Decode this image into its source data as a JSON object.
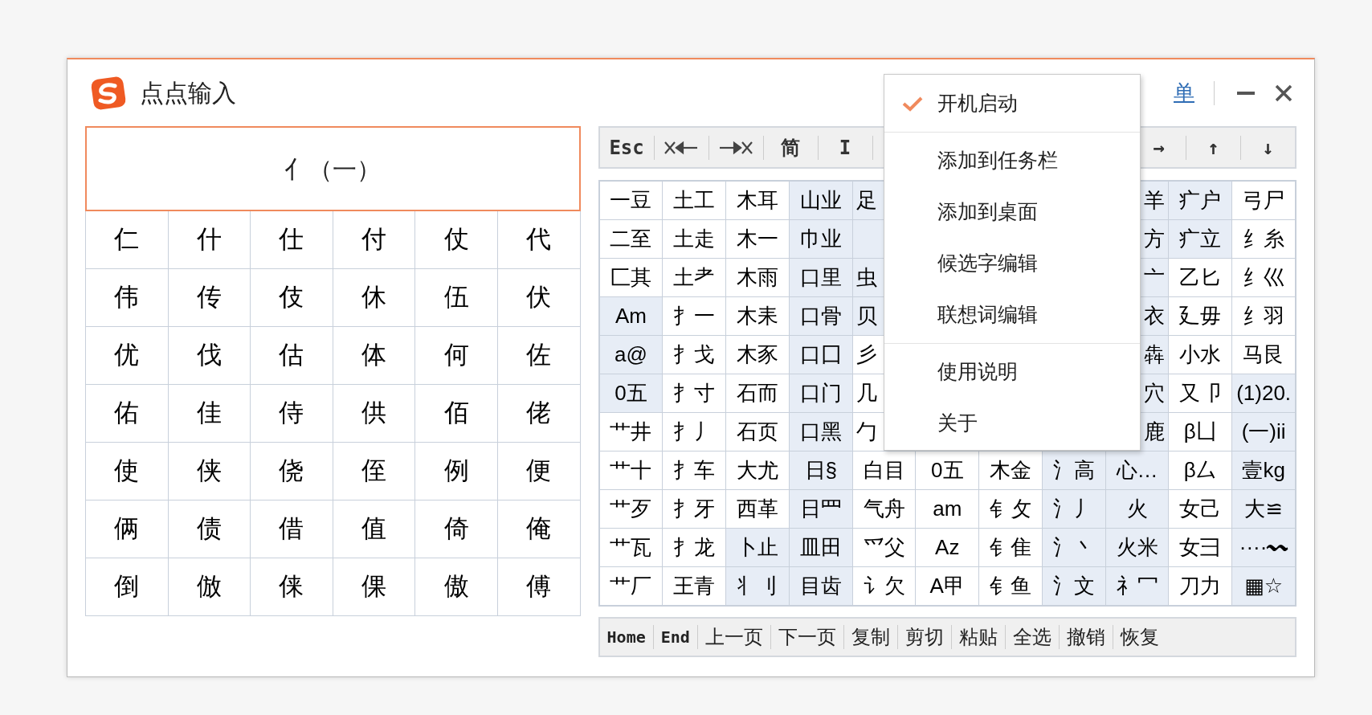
{
  "window": {
    "title": "点点输入",
    "menu_link": "单"
  },
  "candidate_header": "亻（一）",
  "candidates": [
    [
      "仁",
      "什",
      "仕",
      "付",
      "仗",
      "代"
    ],
    [
      "伟",
      "传",
      "伎",
      "休",
      "伍",
      "伏"
    ],
    [
      "优",
      "伐",
      "估",
      "体",
      "何",
      "佐"
    ],
    [
      "佑",
      "佳",
      "侍",
      "供",
      "佰",
      "佬"
    ],
    [
      "使",
      "侠",
      "侥",
      "侄",
      "例",
      "便"
    ],
    [
      "俩",
      "债",
      "借",
      "值",
      "倚",
      "俺"
    ],
    [
      "倒",
      "倣",
      "俫",
      "倮",
      "傲",
      "傅"
    ]
  ],
  "toolbar_left": [
    {
      "kind": "text",
      "label": "Esc"
    },
    {
      "kind": "delete-before"
    },
    {
      "kind": "delete-after"
    },
    {
      "kind": "text",
      "label": "简"
    },
    {
      "kind": "text",
      "label": "I"
    }
  ],
  "toolbar_right": [
    {
      "kind": "text",
      "label": "→"
    },
    {
      "kind": "text",
      "label": "↑"
    },
    {
      "kind": "text",
      "label": "↓"
    }
  ],
  "radicals": [
    [
      {
        "text": "一豆",
        "shaded": false
      },
      {
        "text": "土工",
        "shaded": false
      },
      {
        "text": "木耳",
        "shaded": false
      },
      {
        "text": "山业",
        "shaded": true
      },
      {
        "text": "足",
        "shaded": true
      },
      {
        "text": "羊",
        "shaded": true
      },
      {
        "text": "疒户",
        "shaded": true
      },
      {
        "text": "弓尸",
        "shaded": false
      }
    ],
    [
      {
        "text": "二至",
        "shaded": false
      },
      {
        "text": "土走",
        "shaded": false
      },
      {
        "text": "木一",
        "shaded": false
      },
      {
        "text": "巾业",
        "shaded": true
      },
      {
        "shaded": true
      },
      {
        "text": "方",
        "shaded": true
      },
      {
        "text": "疒立",
        "shaded": true
      },
      {
        "text": "纟糸",
        "shaded": false
      }
    ],
    [
      {
        "text": "匚其",
        "shaded": false
      },
      {
        "text": "土耂",
        "shaded": false
      },
      {
        "text": "木雨",
        "shaded": false
      },
      {
        "text": "口里",
        "shaded": true
      },
      {
        "text": "虫",
        "shaded": true
      },
      {
        "text": "亠",
        "shaded": true
      },
      {
        "text": "乙匕",
        "shaded": false
      },
      {
        "text": "纟巛",
        "shaded": false
      }
    ],
    [
      {
        "text": "Am",
        "shaded": true
      },
      {
        "text": "扌一",
        "shaded": false
      },
      {
        "text": "木耒",
        "shaded": false
      },
      {
        "text": "口骨",
        "shaded": true
      },
      {
        "text": "贝",
        "shaded": true
      },
      {
        "text": "衣",
        "shaded": true
      },
      {
        "text": "廴毋",
        "shaded": false
      },
      {
        "text": "纟羽",
        "shaded": false
      }
    ],
    [
      {
        "text": "a@",
        "shaded": true
      },
      {
        "text": "扌戈",
        "shaded": false
      },
      {
        "text": "木豕",
        "shaded": false
      },
      {
        "text": "口囗",
        "shaded": true
      },
      {
        "text": "彡",
        "shaded": false
      },
      {
        "text": "犇",
        "shaded": true
      },
      {
        "text": "小水",
        "shaded": false
      },
      {
        "text": "马艮",
        "shaded": false
      }
    ],
    [
      {
        "text": "0五",
        "shaded": true
      },
      {
        "text": "扌寸",
        "shaded": false
      },
      {
        "text": "石而",
        "shaded": false
      },
      {
        "text": "口门",
        "shaded": true
      },
      {
        "text": "几",
        "shaded": false
      },
      {
        "text": "穴",
        "shaded": true
      },
      {
        "text": "又卩",
        "shaded": false
      },
      {
        "text": "(1)20.",
        "shaded": true
      }
    ],
    [
      {
        "text": "艹井",
        "shaded": false
      },
      {
        "text": "扌丿",
        "shaded": false
      },
      {
        "text": "石页",
        "shaded": false
      },
      {
        "text": "口黑",
        "shaded": true
      },
      {
        "text": "勹",
        "shaded": false
      },
      {
        "text": "鹿",
        "shaded": true
      },
      {
        "text": "β凵",
        "shaded": false
      },
      {
        "text": "(一)ii",
        "shaded": true
      }
    ],
    [
      {
        "text": "艹十",
        "shaded": false
      },
      {
        "text": "扌车",
        "shaded": false
      },
      {
        "text": "大尤",
        "shaded": false
      },
      {
        "text": "日§",
        "shaded": true
      },
      {
        "text": "白目",
        "shaded": false
      },
      {
        "text": "0五",
        "shaded": false
      },
      {
        "text": "木金",
        "shaded": false
      },
      {
        "text": "氵高",
        "shaded": true
      },
      {
        "text": "心…",
        "shaded": true
      },
      {
        "text": "β厶",
        "shaded": false
      },
      {
        "text": "壹kg",
        "shaded": true
      }
    ],
    [
      {
        "text": "艹歹",
        "shaded": false
      },
      {
        "text": "扌牙",
        "shaded": false
      },
      {
        "text": "西革",
        "shaded": false
      },
      {
        "text": "日罒",
        "shaded": true
      },
      {
        "text": "气舟",
        "shaded": false
      },
      {
        "text": "am",
        "shaded": false
      },
      {
        "text": "钅攵",
        "shaded": false
      },
      {
        "text": "氵丿",
        "shaded": true
      },
      {
        "text": "火",
        "shaded": true
      },
      {
        "text": "女己",
        "shaded": false
      },
      {
        "text": "大≌",
        "shaded": true
      }
    ],
    [
      {
        "text": "艹瓦",
        "shaded": false
      },
      {
        "text": "扌龙",
        "shaded": false
      },
      {
        "text": "卜止",
        "shaded": true
      },
      {
        "text": "皿田",
        "shaded": true
      },
      {
        "text": "爫父",
        "shaded": false
      },
      {
        "text": "Az",
        "shaded": false
      },
      {
        "text": "钅隹",
        "shaded": false
      },
      {
        "text": "氵丶",
        "shaded": true
      },
      {
        "text": "火米",
        "shaded": true
      },
      {
        "text": "女彐",
        "shaded": false
      },
      {
        "text": "····〰",
        "shaded": true
      }
    ],
    [
      {
        "text": "艹厂",
        "shaded": false
      },
      {
        "text": "王青",
        "shaded": false
      },
      {
        "text": "丬刂",
        "shaded": true
      },
      {
        "text": "目齿",
        "shaded": true
      },
      {
        "text": "讠欠",
        "shaded": false
      },
      {
        "text": "A甲",
        "shaded": false
      },
      {
        "text": "钅鱼",
        "shaded": false
      },
      {
        "text": "氵文",
        "shaded": true
      },
      {
        "text": "礻冖",
        "shaded": true
      },
      {
        "text": "刀力",
        "shaded": false
      },
      {
        "text": "▦☆",
        "shaded": true
      }
    ]
  ],
  "bottom_toolbar": [
    "Home",
    "End",
    "上一页",
    "下一页",
    "复制",
    "剪切",
    "粘贴",
    "全选",
    "撤销",
    "恢复"
  ],
  "popup_menu": {
    "groups": [
      [
        {
          "label": "开机启动",
          "checked": true
        }
      ],
      [
        {
          "label": "添加到任务栏",
          "checked": false
        },
        {
          "label": "添加到桌面",
          "checked": false
        },
        {
          "label": "候选字编辑",
          "checked": false
        },
        {
          "label": "联想词编辑",
          "checked": false
        }
      ],
      [
        {
          "label": "使用说明",
          "checked": false
        },
        {
          "label": "关于",
          "checked": false
        }
      ]
    ]
  }
}
